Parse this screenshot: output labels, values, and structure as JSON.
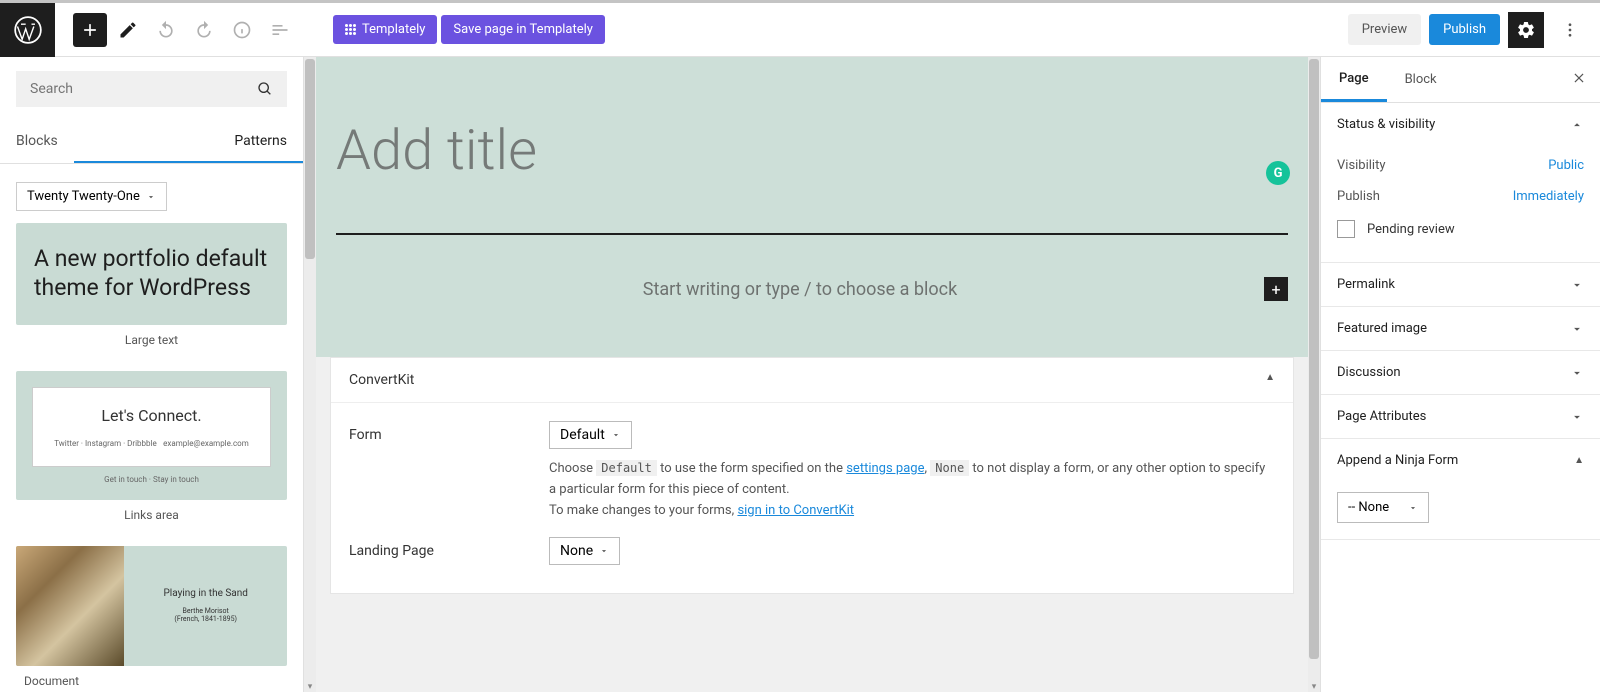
{
  "toolbar": {
    "templately": "Templately",
    "save_templately": "Save page in Templately",
    "preview": "Preview",
    "publish": "Publish"
  },
  "sidebar_left": {
    "search_placeholder": "Search",
    "tabs": {
      "blocks": "Blocks",
      "patterns": "Patterns"
    },
    "theme": "Twenty Twenty-One",
    "patterns": [
      {
        "text": "A new portfolio default theme for WordPress",
        "caption": "Large text"
      },
      {
        "title": "Let's Connect.",
        "link1": "Twitter · Instagram · Dribbble",
        "link2": "example@example.com",
        "sub": "Get in touch · Stay in touch",
        "caption": "Links area"
      },
      {
        "title": "Playing in the Sand",
        "sub": "Berthe Morisot\n(French, 1841-1895)"
      }
    ],
    "document": "Document"
  },
  "canvas": {
    "title_placeholder": "Add title",
    "prompt": "Start writing or type / to choose a block",
    "grammarly": "G",
    "convertkit": {
      "heading": "ConvertKit",
      "form_label": "Form",
      "form_value": "Default",
      "help_pre": "Choose ",
      "help_code1": "Default",
      "help_mid1": " to use the form specified on the ",
      "help_link1": "settings page",
      "help_mid2": ", ",
      "help_code2": "None",
      "help_mid3": " to not display a form, or any other option to specify a particular form for this piece of content.",
      "help2_pre": "To make changes to your forms, ",
      "help2_link": "sign in to ConvertKit",
      "landing_label": "Landing Page",
      "landing_value": "None"
    }
  },
  "sidebar_right": {
    "tabs": {
      "page": "Page",
      "block": "Block"
    },
    "status": {
      "title": "Status & visibility",
      "visibility_label": "Visibility",
      "visibility_value": "Public",
      "publish_label": "Publish",
      "publish_value": "Immediately",
      "pending": "Pending review"
    },
    "panels": {
      "permalink": "Permalink",
      "featured": "Featured image",
      "discussion": "Discussion",
      "attributes": "Page Attributes",
      "ninja": "Append a Ninja Form",
      "ninja_value": "-- None"
    }
  }
}
